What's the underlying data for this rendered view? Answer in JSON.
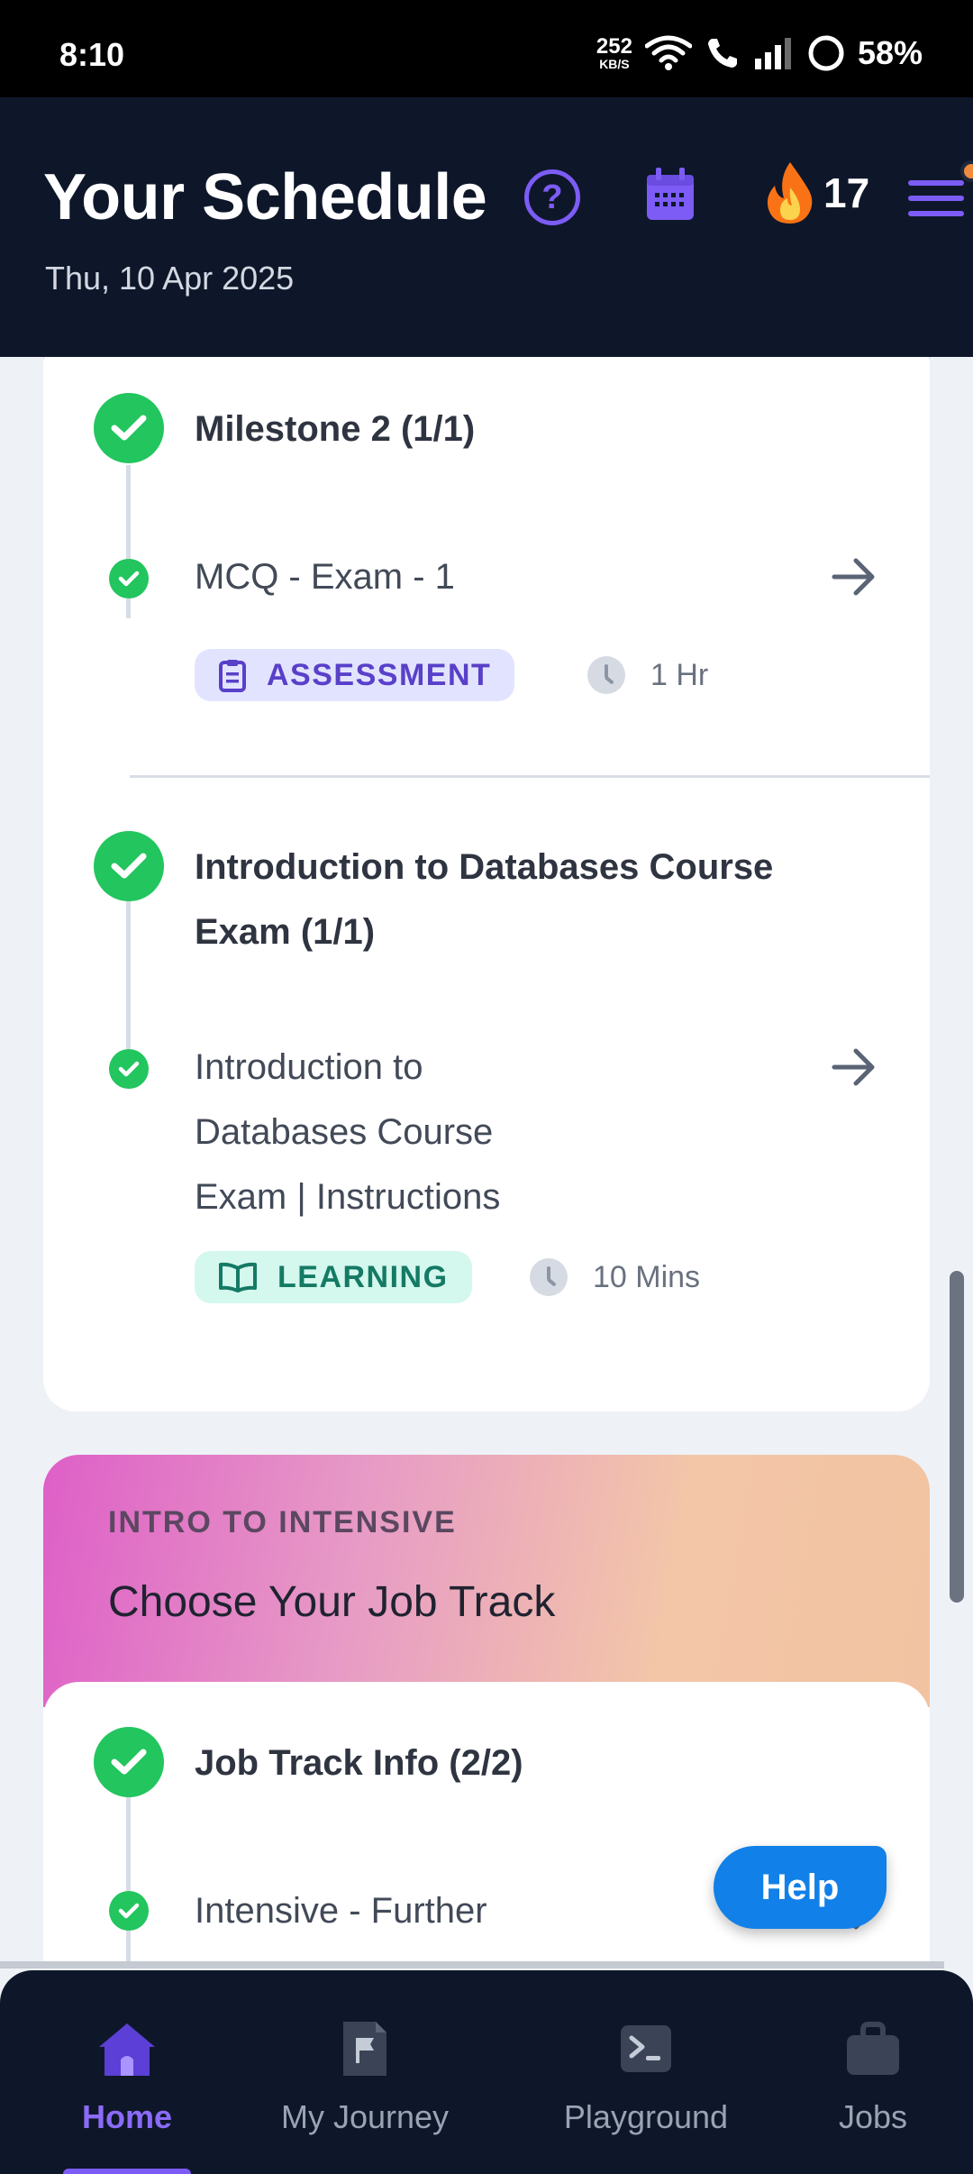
{
  "status_bar": {
    "time": "8:10",
    "net_speed": "252",
    "net_unit": "KB/S",
    "battery": "58%"
  },
  "header": {
    "title": "Your Schedule",
    "date": "Thu, 10 Apr 2025",
    "help_glyph": "?",
    "streak_count": "17",
    "accent_color": "#7c5cf5"
  },
  "course_card": {
    "milestone1": {
      "title": "Milestone 2 (1/1)",
      "item_title": "MCQ - Exam - 1",
      "tag": "ASSESSMENT",
      "duration": "1 Hr"
    },
    "milestone2": {
      "title_line1": "Introduction to Databases Course",
      "title_line2": "Exam (1/1)",
      "item_line1": "Introduction to",
      "item_line2": "Databases Course",
      "item_line3": "Exam | Instructions",
      "tag": "LEARNING",
      "duration": "10 Mins"
    }
  },
  "track_card": {
    "kicker": "INTRO TO INTENSIVE",
    "heading": "Choose Your Job Track",
    "milestone_title": "Job Track Info (2/2)",
    "item_title": "Intensive - Further"
  },
  "help_button": "Help",
  "bottom_nav": {
    "home": "Home",
    "journey": "My Journey",
    "playground": "Playground",
    "jobs": "Jobs"
  }
}
